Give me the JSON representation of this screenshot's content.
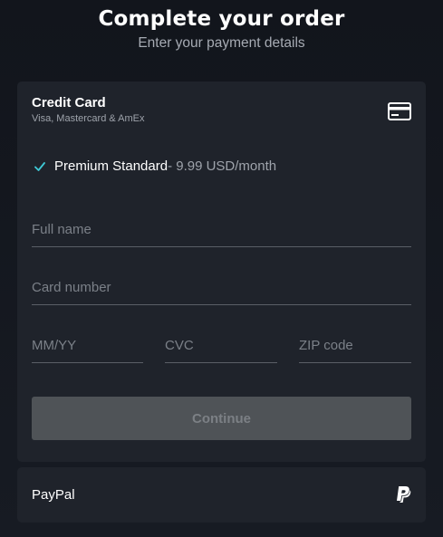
{
  "header": {
    "title": "Complete your order",
    "subtitle": "Enter your payment details"
  },
  "credit_card": {
    "title": "Credit Card",
    "subtitle": "Visa, Mastercard & AmEx",
    "icon": "credit-card-icon",
    "plan": {
      "name": "Premium Standard",
      "price": " - 9.99 USD/month",
      "icon": "check-icon"
    },
    "fields": {
      "full_name": {
        "placeholder": "Full name",
        "value": ""
      },
      "card_number": {
        "placeholder": "Card number",
        "value": ""
      },
      "expiry": {
        "placeholder": "MM/YY",
        "value": ""
      },
      "cvc": {
        "placeholder": "CVC",
        "value": ""
      },
      "zip": {
        "placeholder": "ZIP code",
        "value": ""
      }
    },
    "continue_label": "Continue"
  },
  "paypal": {
    "label": "PayPal",
    "icon": "paypal-icon"
  },
  "colors": {
    "accent_check": "#3ec9d6",
    "card_bg": "#1f232b",
    "button_disabled_bg": "#4f5357"
  }
}
